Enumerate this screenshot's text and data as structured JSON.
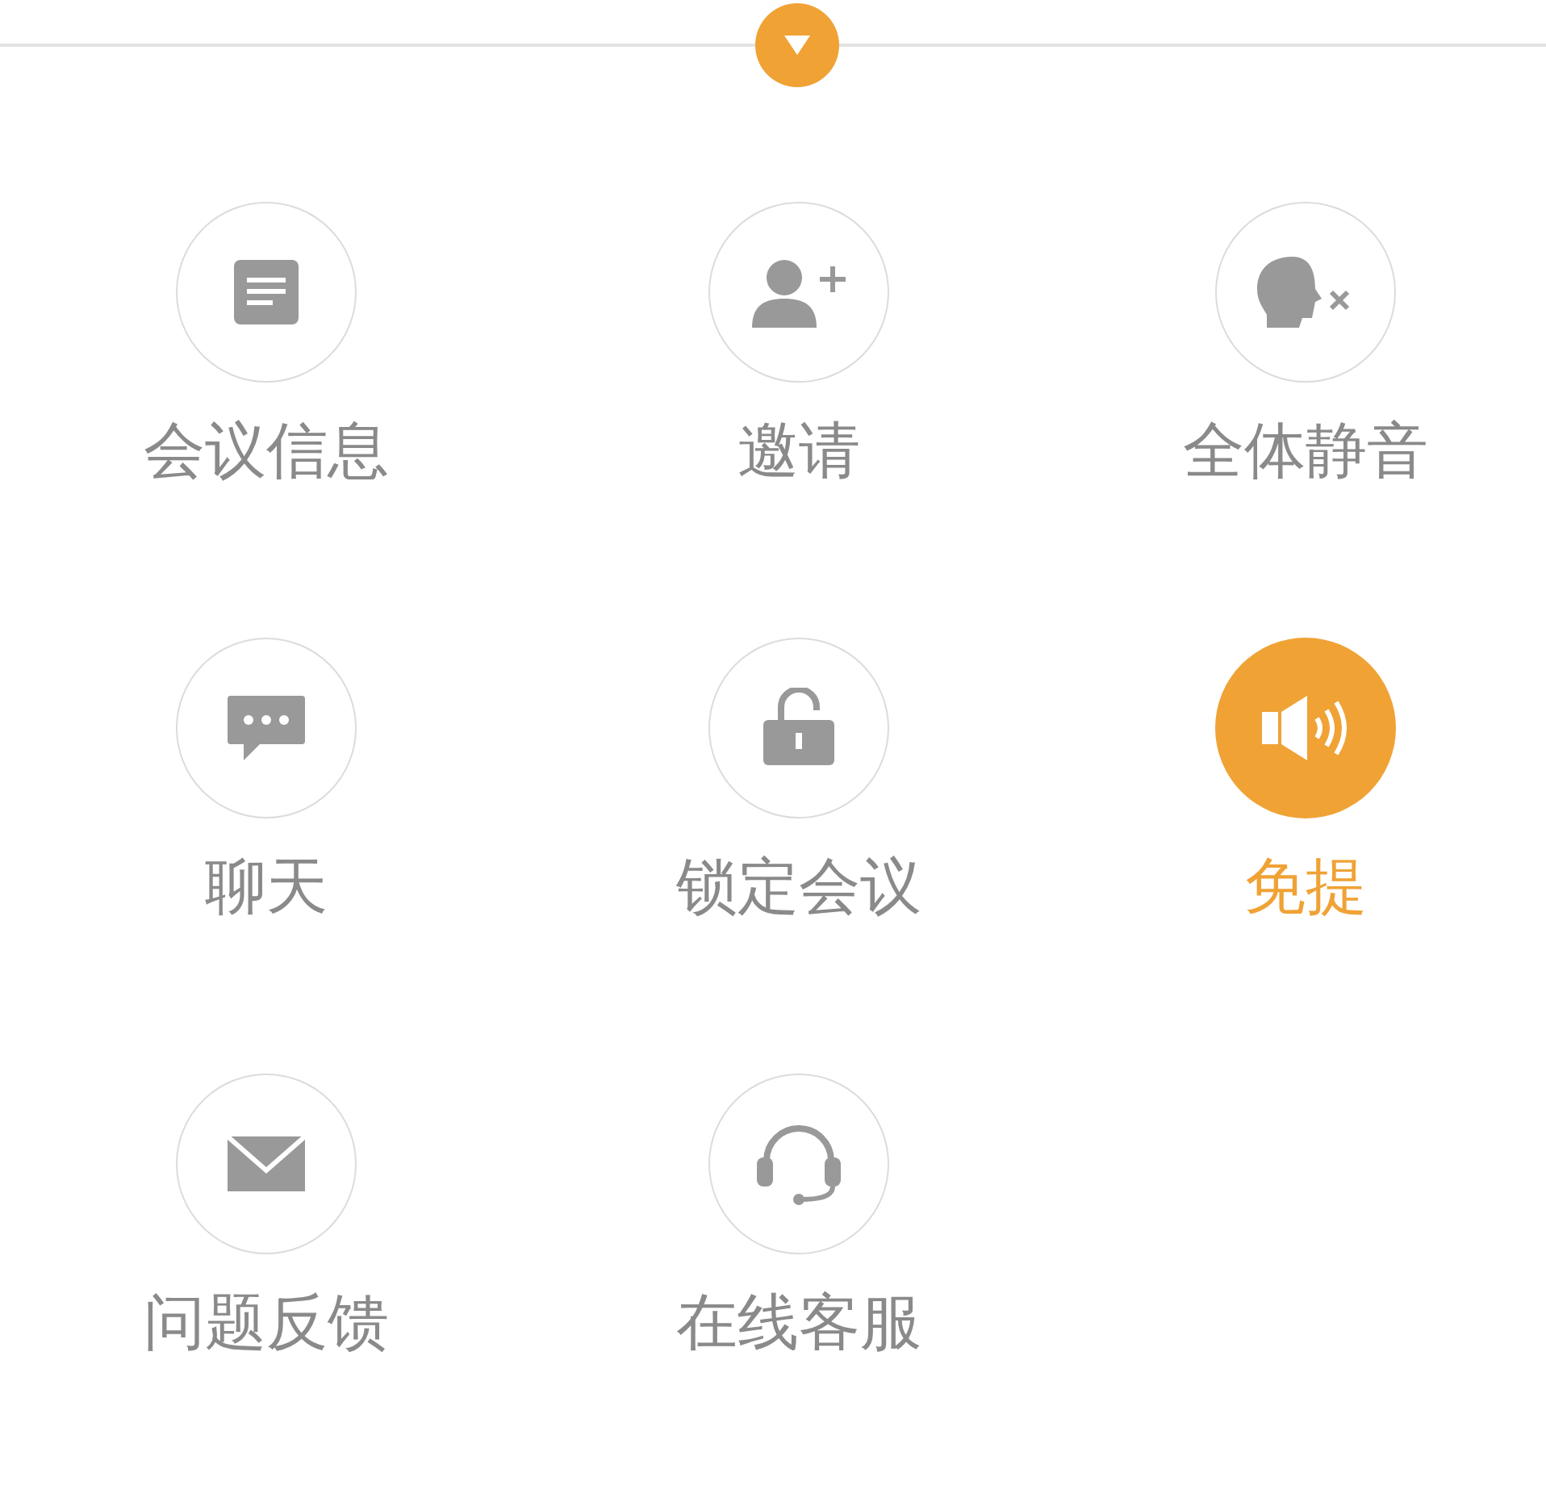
{
  "items": [
    {
      "kind": "document",
      "label": "会议信息",
      "selected": false
    },
    {
      "kind": "invite",
      "label": "邀请",
      "selected": false
    },
    {
      "kind": "mute",
      "label": "全体静音",
      "selected": false
    },
    {
      "kind": "chat",
      "label": "聊天",
      "selected": false
    },
    {
      "kind": "lock",
      "label": "锁定会议",
      "selected": false
    },
    {
      "kind": "speaker",
      "label": "免提",
      "selected": true
    },
    {
      "kind": "mail",
      "label": "问题反馈",
      "selected": false
    },
    {
      "kind": "headset",
      "label": "在线客服",
      "selected": false
    }
  ]
}
